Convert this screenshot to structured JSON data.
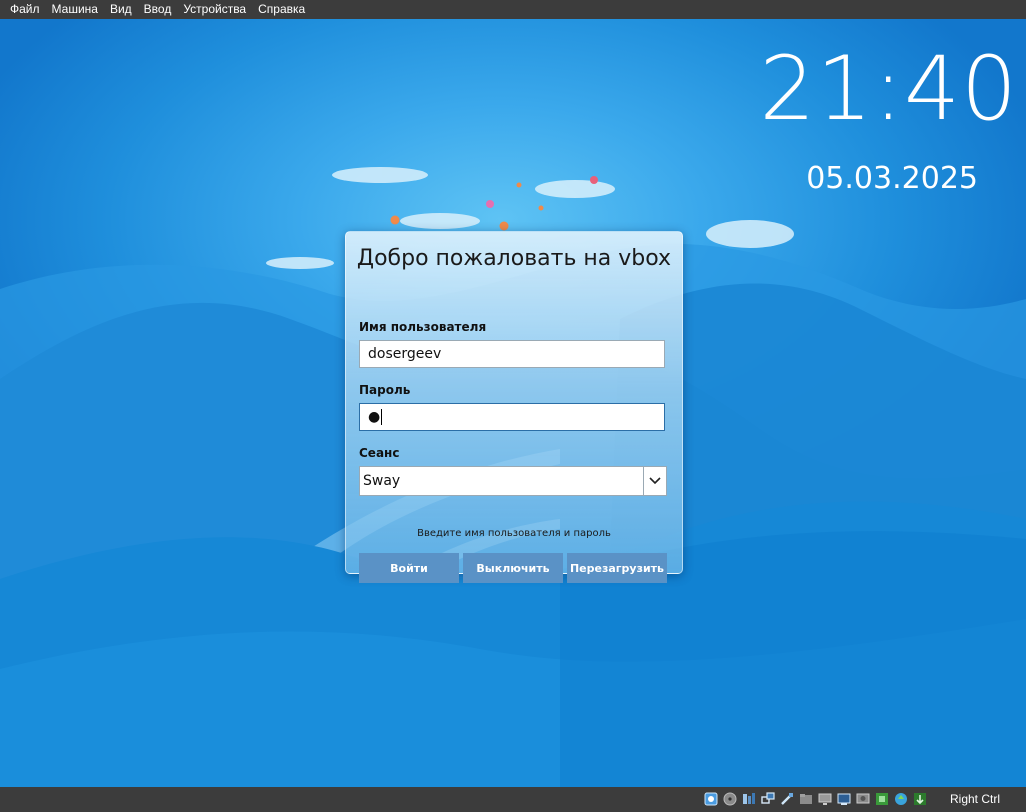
{
  "menubar": {
    "items": [
      "Файл",
      "Машина",
      "Вид",
      "Ввод",
      "Устройства",
      "Справка"
    ]
  },
  "clock": {
    "time": "21:40",
    "date": "05.03.2025"
  },
  "login": {
    "title": "Добро пожаловать на vbox",
    "username_label": "Имя пользователя",
    "username_value": "dosergeev",
    "password_label": "Пароль",
    "password_value": "●",
    "session_label": "Сеанс",
    "session_value": "Sway",
    "hint": "Введите имя пользователя и пароль",
    "buttons": {
      "login": "Войти",
      "shutdown": "Выключить",
      "reboot": "Перезагрузить"
    }
  },
  "statusbar": {
    "icons": [
      "hard-disk-icon",
      "optical-drive-icon",
      "audio-icon",
      "network-icon",
      "usb-icon",
      "shared-folders-icon",
      "display-icon",
      "recording-icon",
      "cpu-icon",
      "mouse-integration-icon",
      "keyboard-capture-icon"
    ],
    "host_key": "Right Ctrl"
  },
  "colors": {
    "menubar_bg": "#3c3c3c",
    "button_bg": "#5a92c6",
    "desktop_blue": "#1d8ad8"
  }
}
